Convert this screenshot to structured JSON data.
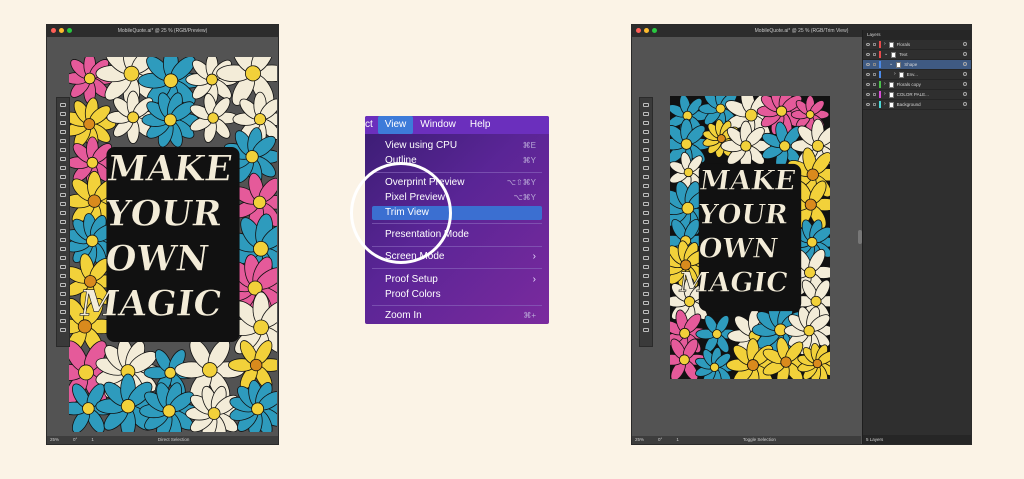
{
  "left_window": {
    "title": "MobileQuote.ai* @ 25 % (RGB/Preview)",
    "status": [
      "25%",
      "0°",
      "1",
      "Direct Selection"
    ]
  },
  "right_window": {
    "title": "MobileQuote.ai* @ 25 % (RGB/Trim View)",
    "status": [
      "25%",
      "0°",
      "1",
      "Toggle Selection"
    ]
  },
  "menu": {
    "menubar": [
      "ct",
      "View",
      "Window",
      "Help"
    ],
    "active_menu": "View",
    "items": [
      {
        "label": "View using CPU",
        "shortcut": "⌘E"
      },
      {
        "label": "Outline",
        "shortcut": "⌘Y"
      },
      {
        "label": "Overprint Preview",
        "shortcut": "⌥⇧⌘Y"
      },
      {
        "label": "Pixel Preview",
        "shortcut": "⌥⌘Y"
      },
      {
        "label": "Trim View",
        "shortcut": "",
        "selected": true
      },
      {
        "label": "Presentation Mode",
        "shortcut": ""
      },
      {
        "label": "Screen Mode",
        "submenu": true
      },
      {
        "label": "Proof Setup",
        "submenu": true
      },
      {
        "label": "Proof Colors",
        "shortcut": ""
      },
      {
        "label": "Zoom In",
        "shortcut": "⌘+"
      }
    ]
  },
  "artwork": {
    "words": [
      "MAKE",
      "YOUR",
      "OWN",
      "MAGIC"
    ]
  },
  "layers_panel": {
    "tab": "Layers",
    "layers": [
      {
        "name": "Florals",
        "color": "#e84a4a",
        "expanded": false,
        "indent": 0
      },
      {
        "name": "Text",
        "color": "#e84a4a",
        "expanded": true,
        "indent": 0
      },
      {
        "name": "Shape",
        "color": "#4a8ae8",
        "expanded": true,
        "indent": 1,
        "selected": true
      },
      {
        "name": "Env...",
        "color": "#4a8ae8",
        "expanded": false,
        "indent": 2
      },
      {
        "name": "Florals copy",
        "color": "#49c44a",
        "expanded": false,
        "indent": 0
      },
      {
        "name": "COLOR PALE...",
        "color": "#d94ad9",
        "expanded": false,
        "indent": 0
      },
      {
        "name": "Background",
        "color": "#4ad9d9",
        "expanded": false,
        "indent": 0
      }
    ],
    "footer": "5 Layers"
  },
  "colors": {
    "canvas": "#535353",
    "artwork_bg": "#111111",
    "pink": "#e55a9a",
    "blue": "#2e9bbd",
    "yellow": "#f2d13a",
    "cream": "#f3ecd8"
  }
}
